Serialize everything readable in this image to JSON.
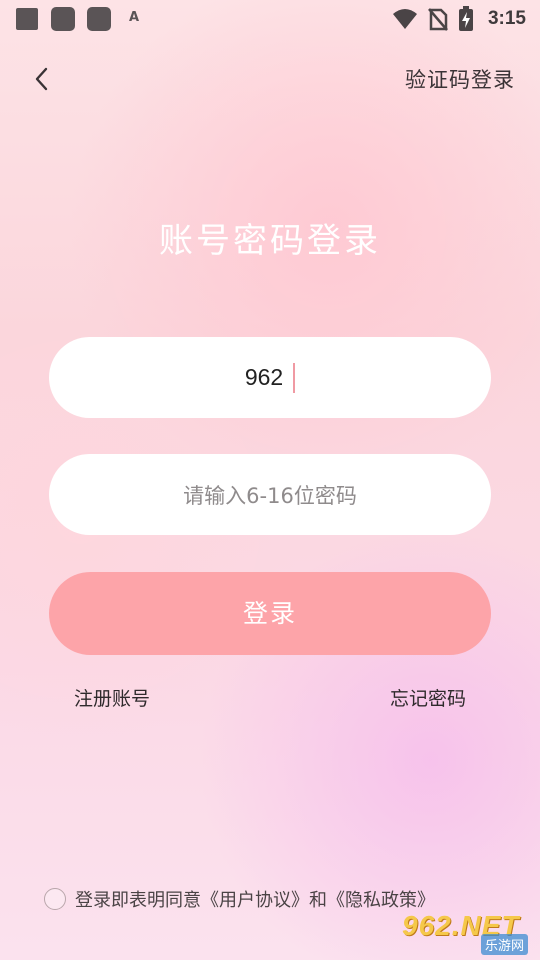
{
  "status_bar": {
    "time": "3:15",
    "notification_icon_label": "A",
    "icons": [
      "app-notification-icon",
      "app-notification-icon",
      "app-notification-icon",
      "font-icon",
      "wifi-icon",
      "no-sim-icon",
      "battery-charging-icon"
    ]
  },
  "header": {
    "back_icon": "chevron-left-icon",
    "switch_mode_label": "验证码登录"
  },
  "title": "账号密码登录",
  "form": {
    "account_value": "962",
    "password_placeholder": "请输入6-16位密码",
    "login_label": "登录",
    "register_label": "注册账号",
    "forgot_label": "忘记密码"
  },
  "agreement": {
    "text": "登录即表明同意《用户协议》和《隐私政策》"
  },
  "watermark": {
    "brand": "962.NET",
    "sub": "乐游网"
  },
  "colors": {
    "login_button": "#fda4a9",
    "caret": "#f09aa3",
    "title_text": "#ffffff"
  }
}
